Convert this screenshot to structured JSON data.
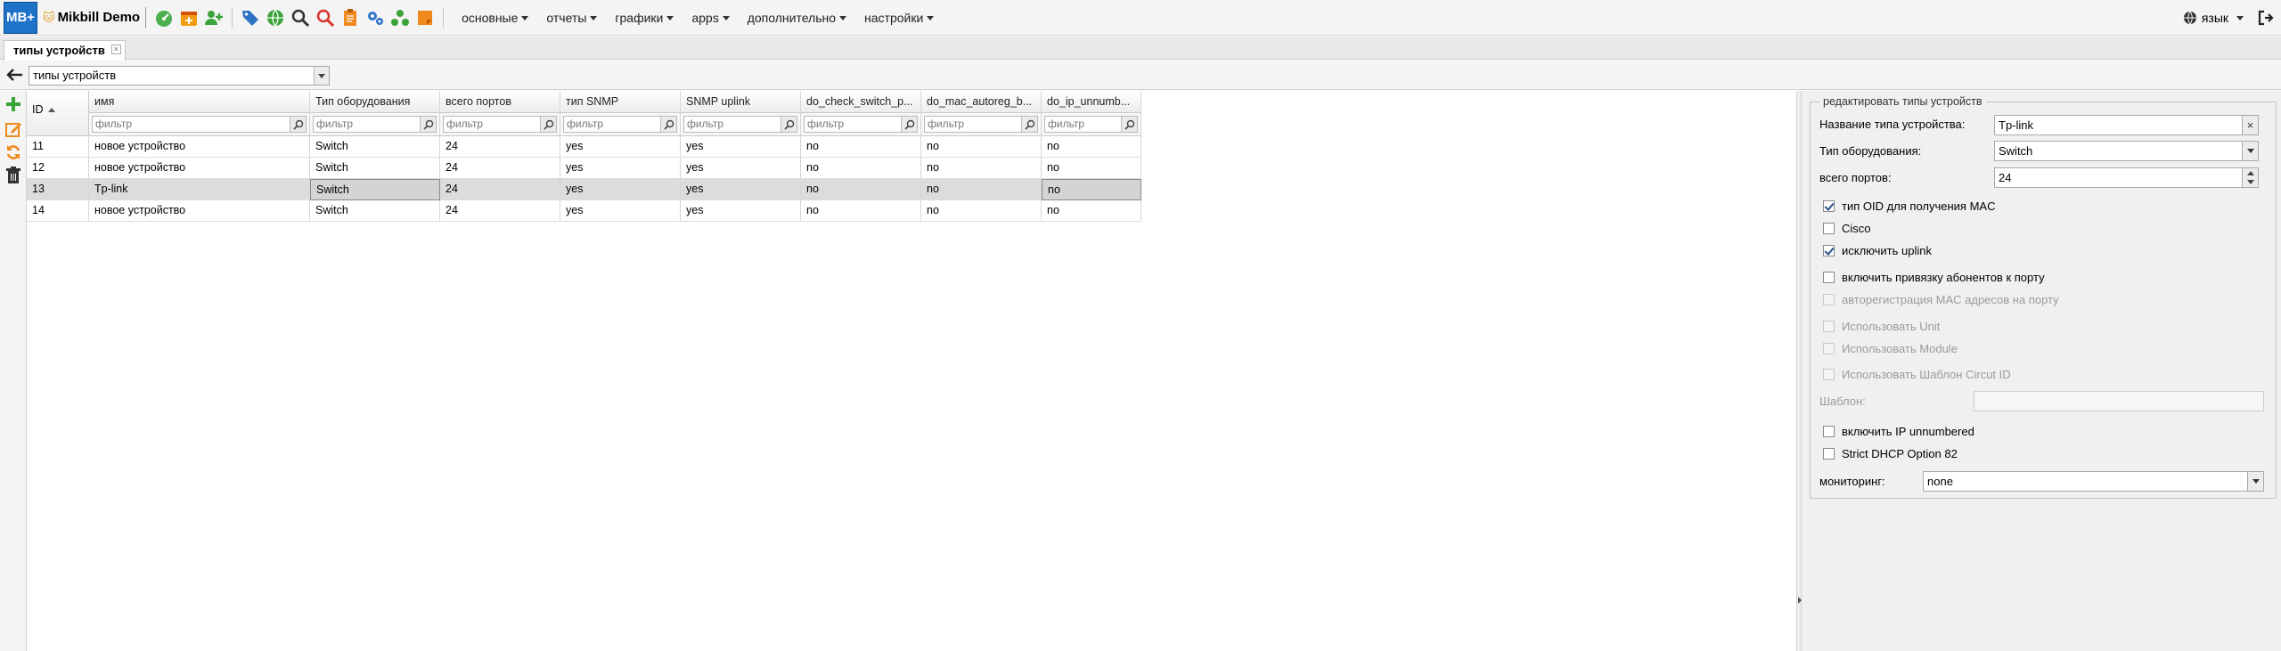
{
  "app": {
    "logo_text": "MB+",
    "brand": "Mikbill Demo"
  },
  "topbar": {
    "icons": [
      "dashboard-icon",
      "calendar-plus-icon",
      "add-user-icon",
      "tags-icon",
      "globe-icon",
      "search-icon",
      "search-red-icon",
      "clipboard-icon",
      "gears-icon",
      "network-icon",
      "notes-icon"
    ],
    "menu": [
      {
        "label": "основные"
      },
      {
        "label": "отчеты"
      },
      {
        "label": "графики"
      },
      {
        "label": "apps"
      },
      {
        "label": "дополнительно"
      },
      {
        "label": "настройки"
      }
    ],
    "language_label": "язык"
  },
  "tabs": [
    {
      "label": "типы устройств",
      "close": "×"
    }
  ],
  "toolbar": {
    "selector_value": "типы устройств"
  },
  "grid": {
    "columns": [
      {
        "key": "id",
        "label": "ID"
      },
      {
        "key": "name",
        "label": "имя"
      },
      {
        "key": "hw",
        "label": "Тип оборудования"
      },
      {
        "key": "ports",
        "label": "всего портов"
      },
      {
        "key": "snmp",
        "label": "тип SNMP"
      },
      {
        "key": "uplink",
        "label": "SNMP uplink"
      },
      {
        "key": "check",
        "label": "do_check_switch_p..."
      },
      {
        "key": "macreg",
        "label": "do_mac_autoreg_b..."
      },
      {
        "key": "ipunnum",
        "label": "do_ip_unnumb..."
      }
    ],
    "filter_placeholder": "фильтр",
    "rows": [
      {
        "id": "11",
        "name": "новое устройство",
        "hw": "Switch",
        "ports": "24",
        "snmp": "yes",
        "uplink": "yes",
        "check": "no",
        "macreg": "no",
        "ipunnum": "no"
      },
      {
        "id": "12",
        "name": "новое устройство",
        "hw": "Switch",
        "ports": "24",
        "snmp": "yes",
        "uplink": "yes",
        "check": "no",
        "macreg": "no",
        "ipunnum": "no"
      },
      {
        "id": "13",
        "name": "Tp-link",
        "hw": "Switch",
        "ports": "24",
        "snmp": "yes",
        "uplink": "yes",
        "check": "no",
        "macreg": "no",
        "ipunnum": "no"
      },
      {
        "id": "14",
        "name": "новое устройство",
        "hw": "Switch",
        "ports": "24",
        "snmp": "yes",
        "uplink": "yes",
        "check": "no",
        "macreg": "no",
        "ipunnum": "no"
      }
    ],
    "selected_row_id": "13"
  },
  "editor": {
    "legend": "редактировать типы устройств",
    "name_label": "Название типа устройства:",
    "name_value": "Tp-link",
    "name_clear": "×",
    "hw_label": "Тип оборудования:",
    "hw_value": "Switch",
    "ports_label": "всего портов:",
    "ports_value": "24",
    "checks": [
      {
        "label": "тип OID для получения MAC",
        "checked": true,
        "disabled": false
      },
      {
        "label": "Cisco",
        "checked": false,
        "disabled": false
      },
      {
        "label": "исключить uplink",
        "checked": true,
        "disabled": false
      },
      {
        "label": "включить привязку абонентов к порту",
        "checked": false,
        "disabled": false
      },
      {
        "label": "авторегистрация MAC адресов на порту",
        "checked": false,
        "disabled": true
      },
      {
        "label": "Использовать Unit",
        "checked": false,
        "disabled": true
      },
      {
        "label": "Использовать Module",
        "checked": false,
        "disabled": true
      },
      {
        "label": "Использовать Шаблон Circut ID",
        "checked": false,
        "disabled": true
      }
    ],
    "template_label": "Шаблон:",
    "template_value": "",
    "checks2": [
      {
        "label": "включить IP unnumbered",
        "checked": false,
        "disabled": false
      },
      {
        "label": "Strict DHCP Option 82",
        "checked": false,
        "disabled": false
      }
    ],
    "monitoring_label": "мониторинг:",
    "monitoring_value": "none"
  },
  "colors": {
    "logo_bg": "#1e73c8",
    "add_green": "#3aa33a",
    "edit_orange": "#f08a1c",
    "search_red": "#d9342b"
  }
}
